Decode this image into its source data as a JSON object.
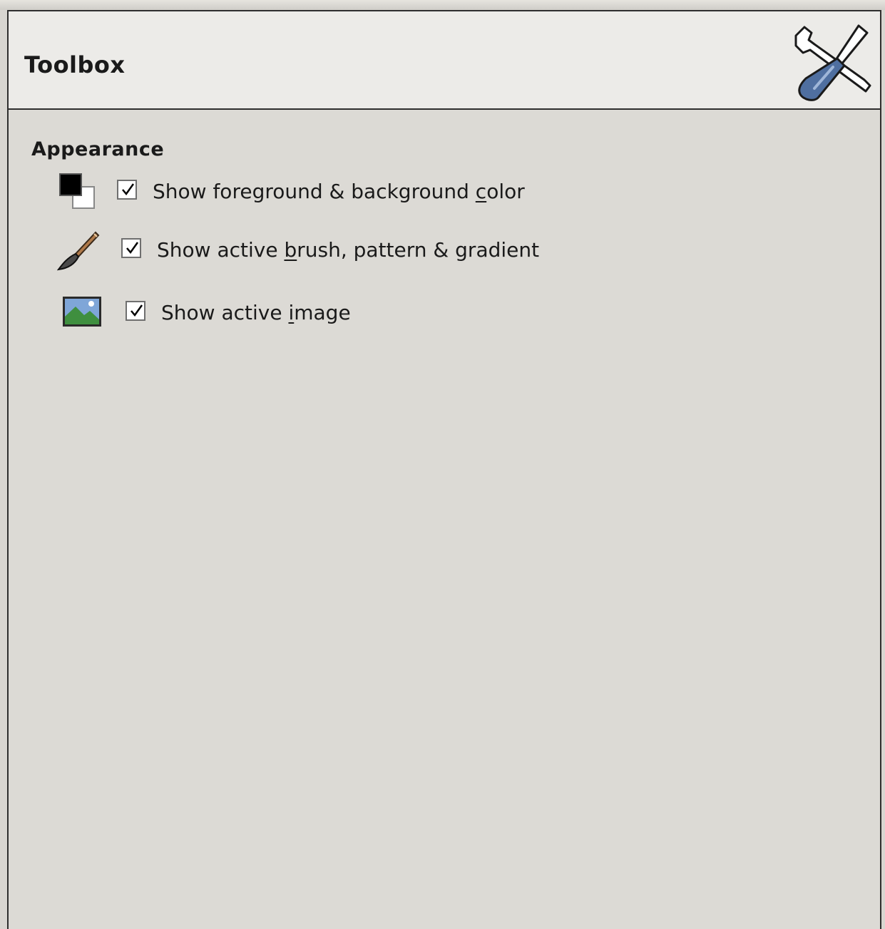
{
  "header": {
    "title": "Toolbox",
    "icon": "wrench-screwdriver-icon"
  },
  "appearance": {
    "title": "Appearance",
    "options": [
      {
        "label_pre": "Show foreground & background ",
        "label_mnemonic": "c",
        "label_post": "olor",
        "checked": true,
        "icon": "fg-bg-color-icon"
      },
      {
        "label_pre": "Show active ",
        "label_mnemonic": "b",
        "label_post": "rush, pattern & gradient",
        "checked": true,
        "icon": "paintbrush-icon"
      },
      {
        "label_pre": "Show active ",
        "label_mnemonic": "i",
        "label_post": "mage",
        "checked": true,
        "icon": "image-icon"
      }
    ]
  },
  "colors": {
    "background": "#dcdad5",
    "header_background": "#ecebe8",
    "border": "#2e2e2e"
  }
}
